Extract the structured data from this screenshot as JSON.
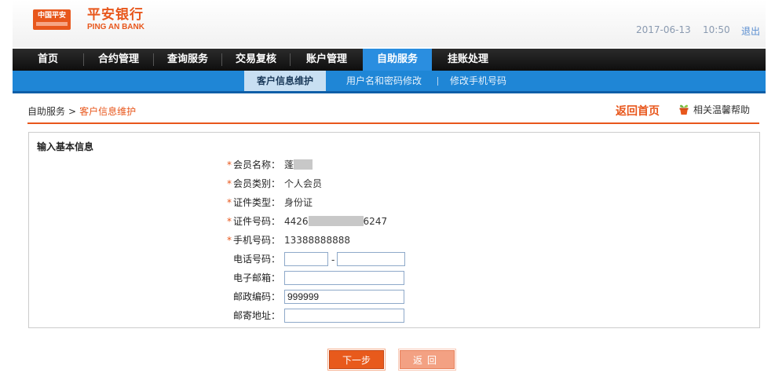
{
  "header": {
    "logo_badge": "中国平安",
    "brand_cn": "平安银行",
    "brand_en": "PING AN BANK",
    "date": "2017-06-13",
    "time": "10:50",
    "logout": "退出"
  },
  "nav": {
    "items": [
      {
        "label": "首页"
      },
      {
        "label": "合约管理"
      },
      {
        "label": "查询服务"
      },
      {
        "label": "交易复核"
      },
      {
        "label": "账户管理"
      },
      {
        "label": "自助服务",
        "active": true
      },
      {
        "label": "挂账处理"
      }
    ]
  },
  "subnav": {
    "items": [
      {
        "label": "客户信息维护",
        "active": true
      },
      {
        "label": "用户名和密码修改"
      },
      {
        "label": "修改手机号码"
      }
    ]
  },
  "breadcrumb": {
    "parent": "自助服务",
    "separator": ">",
    "current": "客户信息维护"
  },
  "links": {
    "home": "返回首页",
    "help": "相关温馨帮助"
  },
  "form": {
    "section_title": "输入基本信息",
    "fields": {
      "member_name": {
        "label": "会员名称：",
        "value": "蓬"
      },
      "member_type": {
        "label": "会员类别：",
        "value": "个人会员"
      },
      "id_type": {
        "label": "证件类型：",
        "value": "身份证"
      },
      "id_number": {
        "label": "证件号码：",
        "prefix": "4426",
        "suffix": "6247"
      },
      "mobile": {
        "label": "手机号码：",
        "value": "13388888888"
      },
      "phone": {
        "label": "电话号码：",
        "area": "",
        "number": "",
        "dash": "-"
      },
      "email": {
        "label": "电子邮箱：",
        "value": ""
      },
      "postcode": {
        "label": "邮政编码：",
        "value": "999999"
      },
      "address": {
        "label": "邮寄地址：",
        "value": ""
      }
    },
    "required_mark": "*"
  },
  "buttons": {
    "next": "下一步",
    "back": "返回"
  },
  "colors": {
    "brand_orange": "#e8571c",
    "nav_dark": "#1a1a1a",
    "nav_active_blue": "#2a8ee0",
    "subnav_blue": "#1f86d6"
  }
}
